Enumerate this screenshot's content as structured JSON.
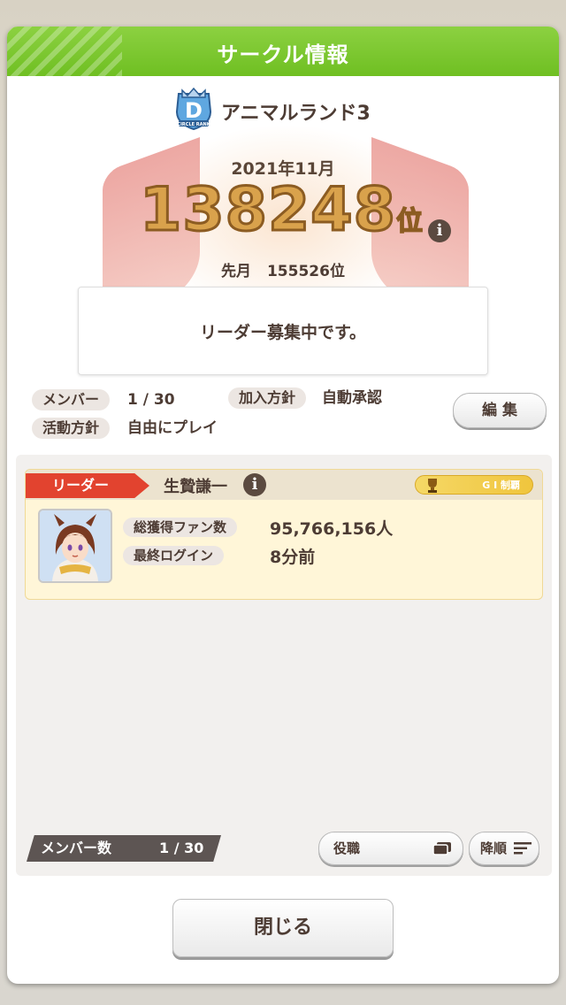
{
  "dialog": {
    "title": "サークル情報"
  },
  "circle": {
    "name": "アニマルランド3",
    "badge_letter": "D",
    "badge_caption": "CIRCLE RANK",
    "month": "2021年11月",
    "rank": "138248",
    "rank_unit": "位",
    "last_month_label": "先月",
    "last_month_value": "155526位",
    "message": "リーダー募集中です。"
  },
  "details": {
    "members_label": "メンバー",
    "members_value": "1 / 30",
    "join_policy_label": "加入方針",
    "join_policy_value": "自動承認",
    "activity_label": "活動方針",
    "activity_value": "自由にプレイ",
    "edit_label": "編 集"
  },
  "leader": {
    "tag": "リーダー",
    "name": "生贄謙一",
    "badge": "G I 制覇",
    "fans_label": "総獲得ファン数",
    "fans_value": "95,766,156人",
    "login_label": "最終ログイン",
    "login_value": "8分前"
  },
  "list_footer": {
    "count_label": "メンバー数",
    "count_value": "1 / 30",
    "role_button": "役職",
    "order_button": "降順"
  },
  "close_label": "閉じる",
  "colors": {
    "header_green": "#7dc832",
    "leader_red": "#e2432f",
    "card_yellow": "#fff6d8"
  }
}
